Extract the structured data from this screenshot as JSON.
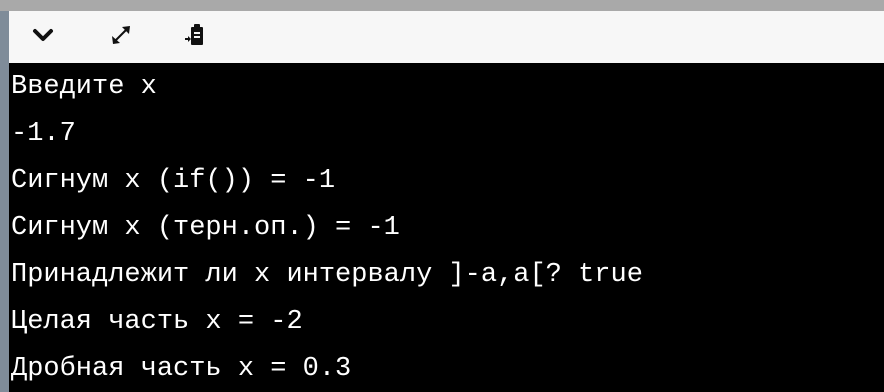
{
  "toolbar": {
    "icons": [
      "chevron-down-icon",
      "expand-icon",
      "clipboard-icon"
    ]
  },
  "console": {
    "lines": [
      "Введите x",
      "-1.7",
      "Сигнум x (if()) = -1",
      "Сигнум x (терн.оп.) = -1",
      "Принадлежит ли x интервалу ]-a,a[? true",
      "Целая часть x = -2",
      "Дробная часть x = 0.3"
    ]
  },
  "colors": {
    "console_bg": "#000000",
    "console_text": "#ffffff",
    "toolbar_bg": "#f7f7f7",
    "left_bar": "#7f8c99",
    "top_line": "#a9a9a9"
  }
}
